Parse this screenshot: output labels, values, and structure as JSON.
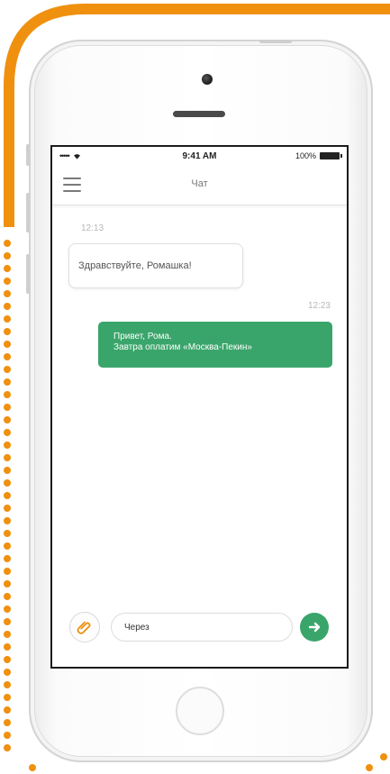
{
  "colors": {
    "accent_orange": "#f0900f",
    "message_green": "#3aa56b"
  },
  "status_bar": {
    "signal": "•••••",
    "time": "9:41 AM",
    "battery": "100%"
  },
  "nav": {
    "title": "Чат",
    "menu_icon": "hamburger-icon"
  },
  "messages": [
    {
      "direction": "incoming",
      "time": "12:13",
      "lines": [
        "Здравствуйте, Ромашка!"
      ]
    },
    {
      "direction": "outgoing",
      "time": "12:23",
      "lines": [
        "Привет, Рома.",
        "Завтра оплатим «Москва-Пекин»"
      ]
    }
  ],
  "composer": {
    "value": "Через",
    "attach_icon": "paperclip-icon",
    "send_icon": "send-arrow-icon"
  }
}
